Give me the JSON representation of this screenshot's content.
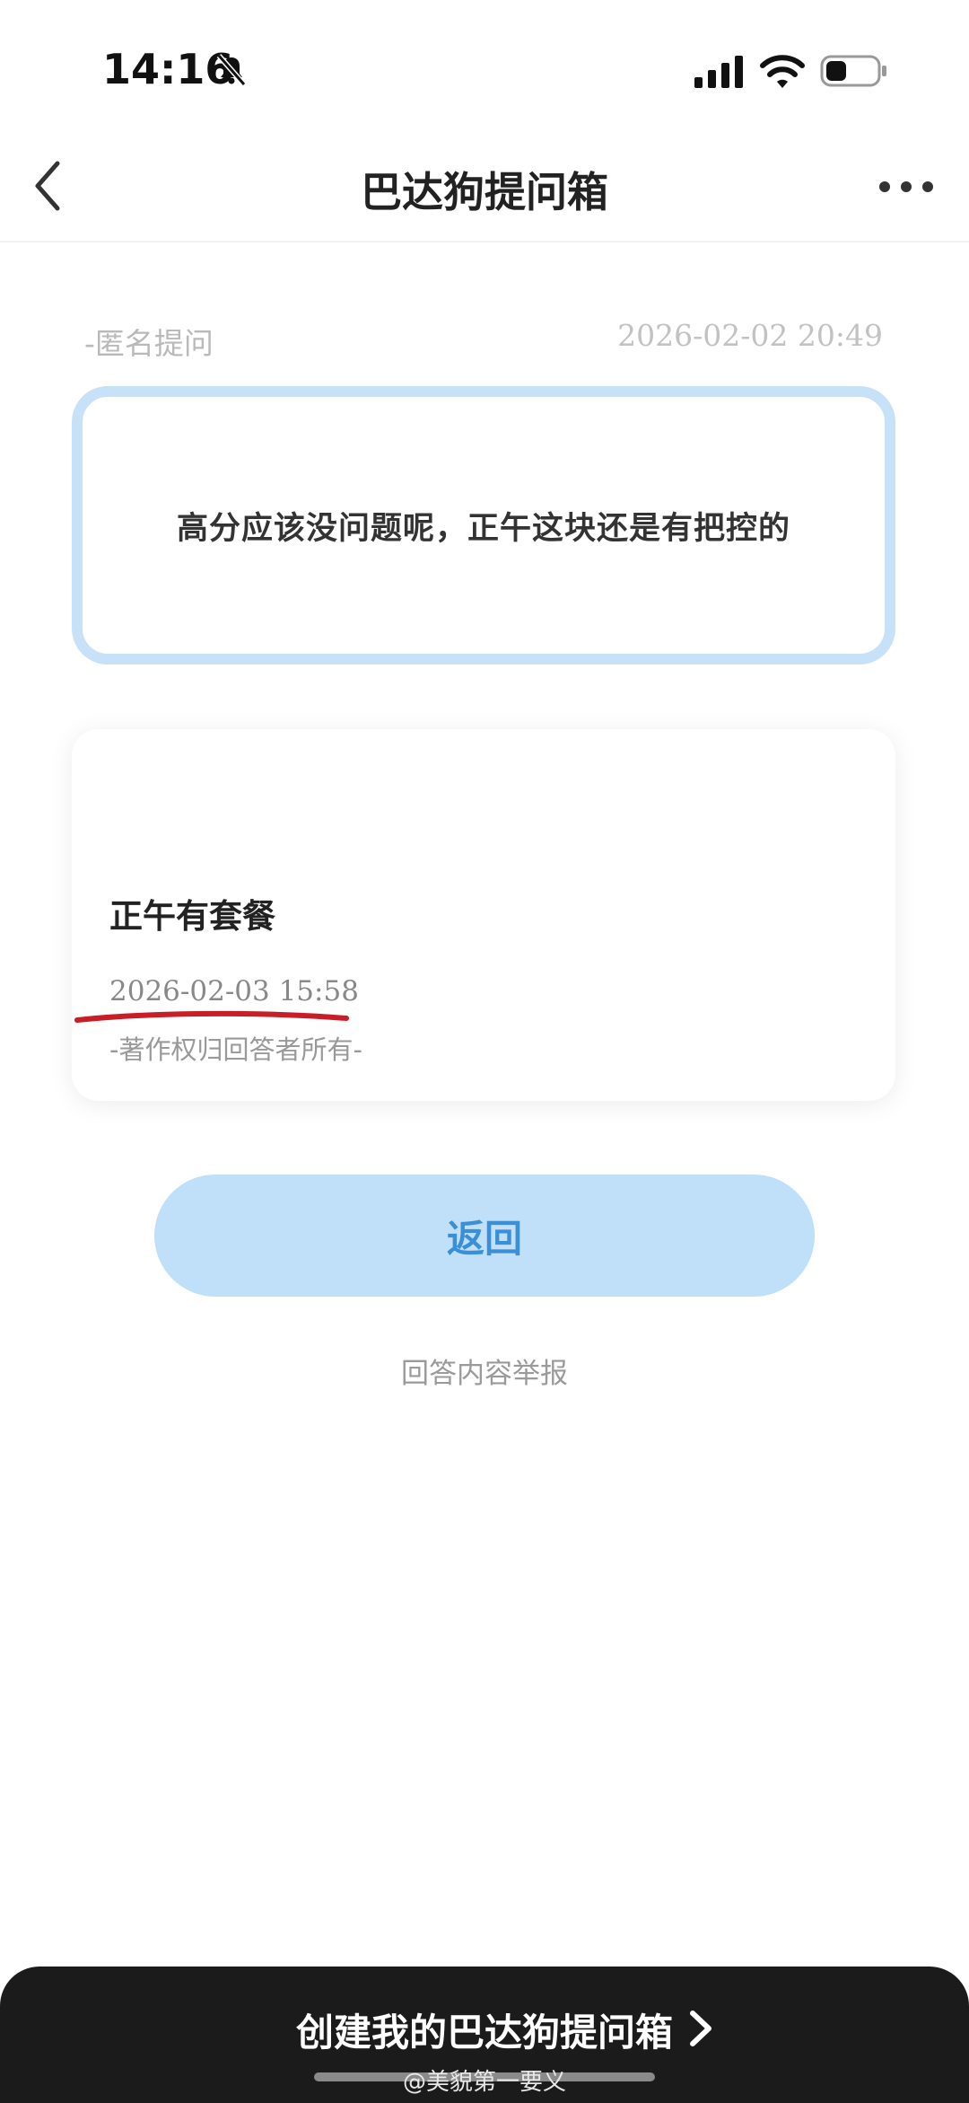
{
  "status_bar": {
    "time": "14:16"
  },
  "nav": {
    "title": "巴达狗提问箱"
  },
  "question": {
    "label": "-匿名提问",
    "time": "2026-02-02 20:49",
    "text": "高分应该没问题呢，正午这块还是有把控的"
  },
  "answer": {
    "text": "正午有套餐",
    "time": "2026-02-03 15:58",
    "copyright": "-著作权归回答者所有-"
  },
  "actions": {
    "return_label": "返回",
    "report_label": "回答内容举报",
    "create_label": "创建我的巴达狗提问箱"
  },
  "watermark": "@美貌第一要义",
  "colors": {
    "accent": "#3b8fd6",
    "button_bg": "#bfe0f8",
    "card_border": "#c7e1f9",
    "bottom_bar": "#1b1b1b",
    "annotation": "#c81e28"
  },
  "icons": {
    "status": [
      "bell-off-icon",
      "signal-icon",
      "wifi-icon",
      "battery-icon"
    ],
    "nav": [
      "back-icon",
      "more-icon"
    ],
    "cta": [
      "chevron-right-icon"
    ]
  }
}
